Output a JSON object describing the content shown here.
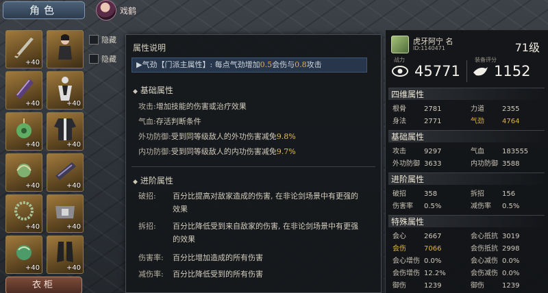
{
  "header": {
    "char_tab": "角色",
    "nickname": "戏鹤"
  },
  "equipment": {
    "slots": [
      {
        "lvl": "+40"
      },
      {
        "lvl": ""
      },
      {
        "lvl": "+40"
      },
      {
        "lvl": "+40"
      },
      {
        "lvl": "+40"
      },
      {
        "lvl": "+40"
      },
      {
        "lvl": "+40"
      },
      {
        "lvl": "+40"
      },
      {
        "lvl": "+40"
      },
      {
        "lvl": "+40"
      },
      {
        "lvl": "+40"
      },
      {
        "lvl": "+40"
      }
    ],
    "clothes_button": "衣柜"
  },
  "toggles": [
    "隐藏",
    "隐藏"
  ],
  "tooltip": {
    "title": "属性说明",
    "highlight_prefix": "▶气劲【门派主属性】: 每点气劲增加",
    "highlight_v1": "0.5",
    "highlight_mid": "会伤与",
    "highlight_v2": "0.8",
    "highlight_suffix": "攻击",
    "basic_title": "基础属性",
    "basic_rows": [
      {
        "k": "攻击:",
        "v": "增加技能的伤害或治疗效果",
        "val": ""
      },
      {
        "k": "气血:",
        "v": "存活判断条件",
        "val": ""
      },
      {
        "k": "外功防御:",
        "v": "受到同等级敌人的外功伤害减免",
        "val": "9.8%"
      },
      {
        "k": "内功防御:",
        "v": "受到同等级敌人的内功伤害减免",
        "val": "9.7%"
      }
    ],
    "adv_title": "进阶属性",
    "adv_rows": [
      {
        "k": "破招:",
        "v": "百分比提高对敌家造成的伤害, 在非论剑场景中有更强的效果"
      },
      {
        "k": "拆招:",
        "v": "百分比降低受到来自敌家的伤害, 在非论剑场景中有更强的效果"
      },
      {
        "k": "伤害率:",
        "v": "百分比增加造成的所有伤害"
      },
      {
        "k": "减伤率:",
        "v": "百分比降低受到的所有伤害"
      }
    ]
  },
  "player": {
    "name": "虎牙阿宁 名",
    "id": "ID:1140471",
    "level": "71级",
    "power_label": "战力",
    "power": "45771",
    "score_label": "装备评分",
    "score": "1152",
    "sections": {
      "four": "四维属性",
      "basic": "基础属性",
      "advanced": "进阶属性",
      "special": "特殊属性"
    },
    "four_stats": [
      {
        "k": "根骨",
        "v": "2781",
        "hl": false
      },
      {
        "k": "力道",
        "v": "2355",
        "hl": false
      },
      {
        "k": "身法",
        "v": "2771",
        "hl": false
      },
      {
        "k": "气劲",
        "v": "4764",
        "hl": true
      }
    ],
    "basic_stats": [
      {
        "k": "攻击",
        "v": "9297"
      },
      {
        "k": "气血",
        "v": "183555"
      },
      {
        "k": "外功防御",
        "v": "3633"
      },
      {
        "k": "内功防御",
        "v": "3588"
      }
    ],
    "adv_stats": [
      {
        "k": "破招",
        "v": "358"
      },
      {
        "k": "拆招",
        "v": "156"
      },
      {
        "k": "伤害率",
        "v": "0.5%"
      },
      {
        "k": "减伤率",
        "v": "0.5%"
      }
    ],
    "special_stats": [
      {
        "k": "会心",
        "v": "2667",
        "hl": false
      },
      {
        "k": "会心抵抗",
        "v": "3019",
        "hl": false
      },
      {
        "k": "会伤",
        "v": "7066",
        "hl": true
      },
      {
        "k": "会伤抵抗",
        "v": "2998",
        "hl": false
      },
      {
        "k": "会心增伤",
        "v": "0.0%",
        "hl": false
      },
      {
        "k": "会心减伤",
        "v": "0.0%",
        "hl": false
      },
      {
        "k": "会伤增伤",
        "v": "12.2%",
        "hl": false
      },
      {
        "k": "会伤减伤",
        "v": "0.0%",
        "hl": false
      },
      {
        "k": "御伤",
        "v": "1239",
        "hl": false
      },
      {
        "k": "御伤",
        "v": "1239",
        "hl": false
      }
    ]
  }
}
